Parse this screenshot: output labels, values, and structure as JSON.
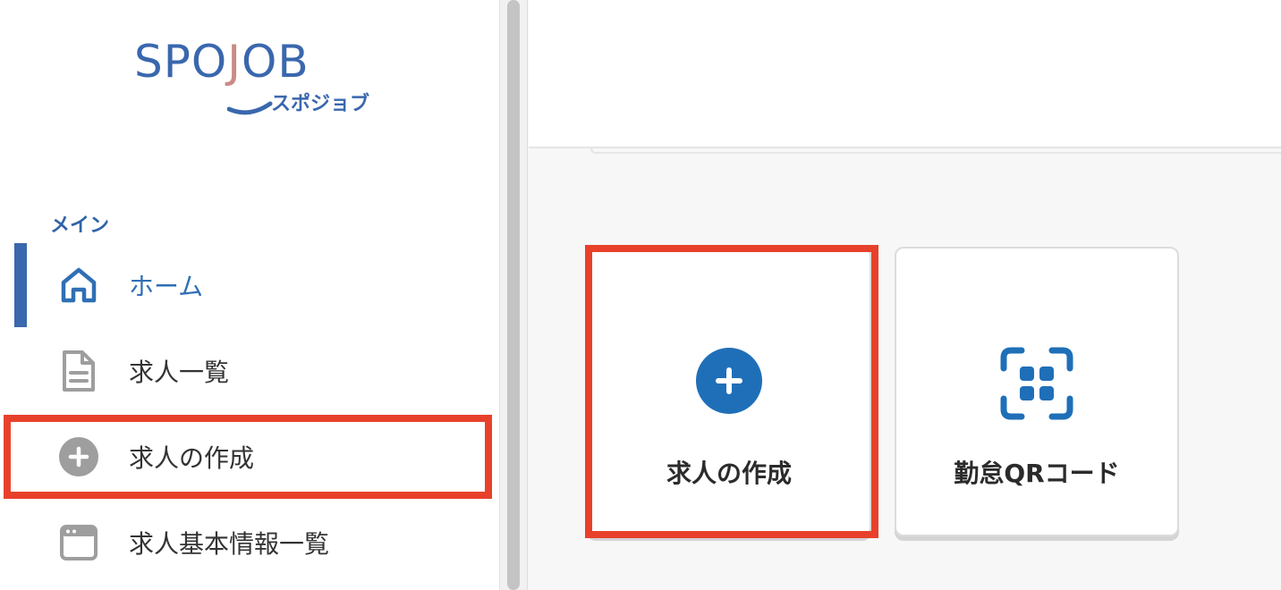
{
  "brand": {
    "logo_main_a": "SPO",
    "logo_main_j": "J",
    "logo_main_b": "OB",
    "logo_sub": "スポジョブ"
  },
  "sidebar": {
    "section_label": "メイン",
    "items": [
      {
        "label": "ホーム",
        "icon": "home-icon",
        "active": true
      },
      {
        "label": "求人一覧",
        "icon": "document-icon",
        "active": false
      },
      {
        "label": "求人の作成",
        "icon": "plus-circle-icon",
        "active": false,
        "highlighted": true
      },
      {
        "label": "求人基本情報一覧",
        "icon": "window-icon",
        "active": false
      }
    ]
  },
  "main": {
    "tiles": [
      {
        "label": "求人の作成",
        "icon": "plus-circle-icon",
        "highlighted": true
      },
      {
        "label": "勤怠QRコード",
        "icon": "qr-scan-icon",
        "highlighted": false
      }
    ]
  },
  "colors": {
    "accent": "#3a67ad",
    "active_text": "#2f6fb5",
    "highlight": "#e8412b",
    "icon_blue": "#1f6fb8",
    "icon_gray": "#9e9e9e"
  }
}
